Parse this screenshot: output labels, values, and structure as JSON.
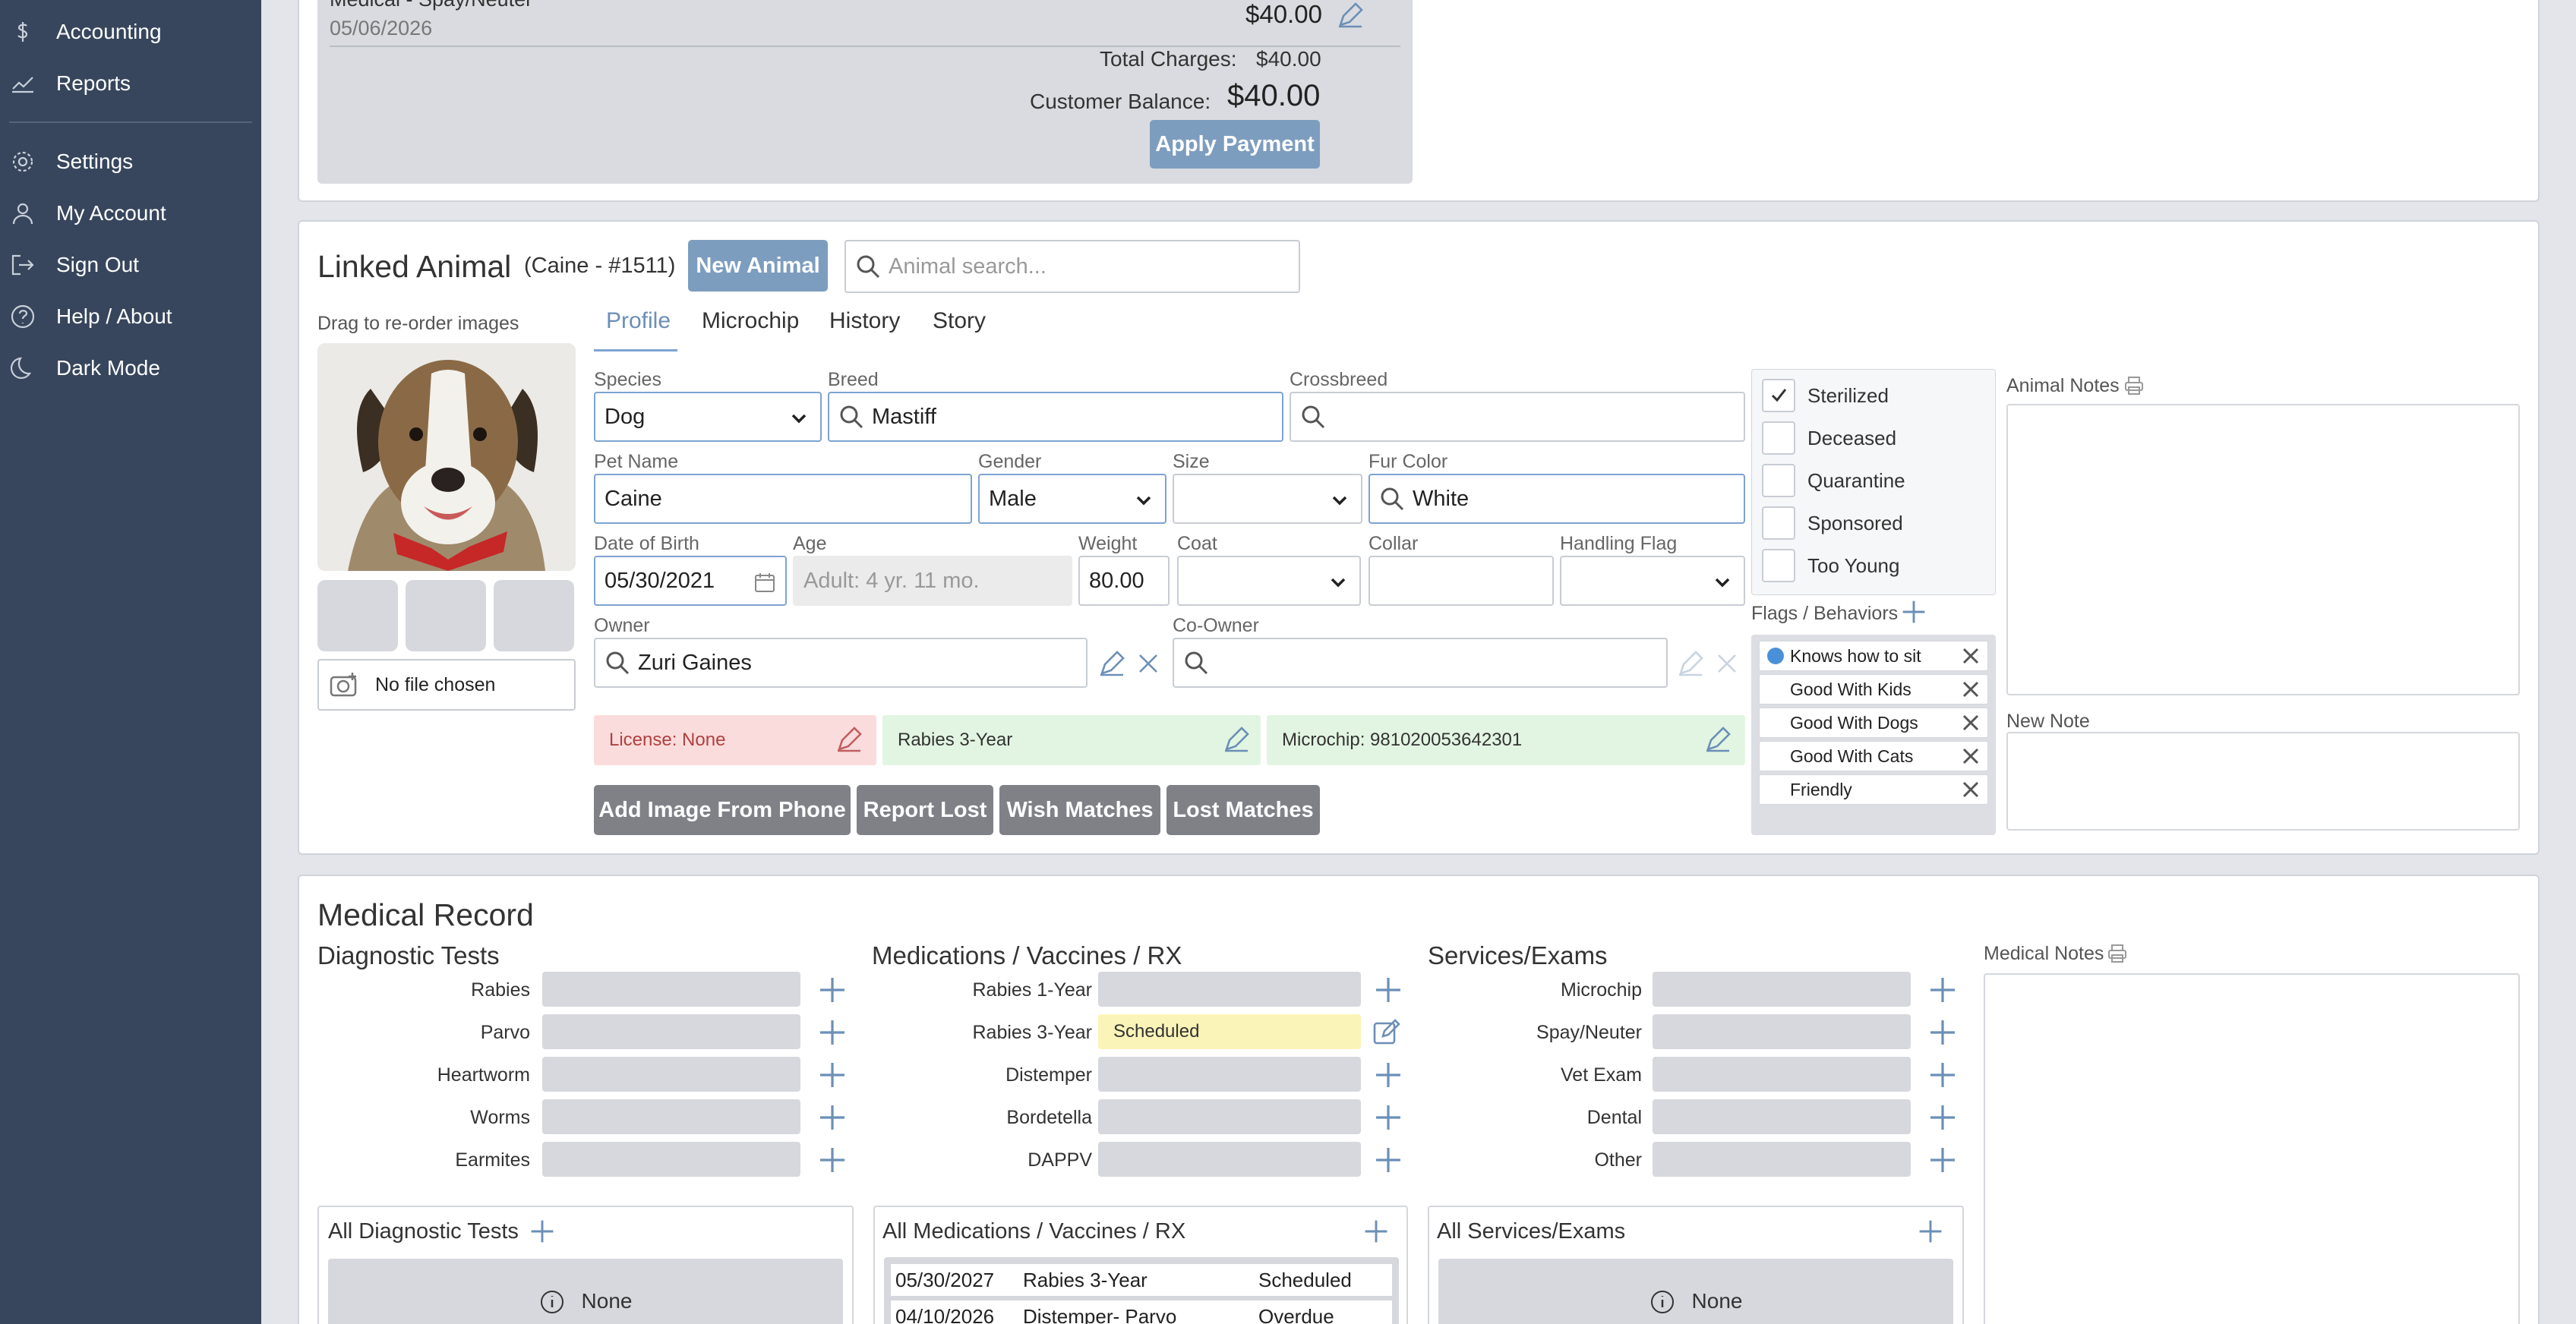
{
  "sidebar": {
    "items": [
      {
        "label": "Accounting",
        "icon": "dollar-icon"
      },
      {
        "label": "Reports",
        "icon": "chart-icon"
      },
      {
        "label": "Settings",
        "icon": "gear-icon"
      },
      {
        "label": "My Account",
        "icon": "user-icon"
      },
      {
        "label": "Sign Out",
        "icon": "sign-out-icon"
      },
      {
        "label": "Help / About",
        "icon": "help-icon"
      },
      {
        "label": "Dark Mode",
        "icon": "moon-icon"
      }
    ]
  },
  "charges": {
    "item_name": "Medical - Spay/Neuter",
    "item_date": "05/06/2026",
    "item_amount": "$40.00",
    "total_label": "Total Charges:",
    "total_value": "$40.00",
    "balance_label": "Customer Balance:",
    "balance_value": "$40.00",
    "apply_payment": "Apply Payment"
  },
  "linked_animal": {
    "title": "Linked Animal",
    "subtitle": "(Caine - #1511)",
    "new_animal": "New Animal",
    "search_placeholder": "Animal search...",
    "drag_hint": "Drag to re-order images",
    "no_file": "No file chosen",
    "tabs": [
      "Profile",
      "Microchip",
      "History",
      "Story"
    ],
    "fields": {
      "species": {
        "label": "Species",
        "value": "Dog"
      },
      "breed": {
        "label": "Breed",
        "value": "Mastiff"
      },
      "crossbreed": {
        "label": "Crossbreed",
        "value": ""
      },
      "pet_name": {
        "label": "Pet Name",
        "value": "Caine"
      },
      "gender": {
        "label": "Gender",
        "value": "Male"
      },
      "size": {
        "label": "Size",
        "value": ""
      },
      "fur_color": {
        "label": "Fur Color",
        "value": "White"
      },
      "dob": {
        "label": "Date of Birth",
        "value": "05/30/2021"
      },
      "age": {
        "label": "Age",
        "value": "Adult: 4 yr. 11 mo."
      },
      "weight": {
        "label": "Weight",
        "value": "80.00"
      },
      "coat": {
        "label": "Coat",
        "value": ""
      },
      "collar": {
        "label": "Collar",
        "value": ""
      },
      "handling_flag": {
        "label": "Handling Flag",
        "value": ""
      },
      "owner": {
        "label": "Owner",
        "value": "Zuri Gaines"
      },
      "co_owner": {
        "label": "Co-Owner",
        "value": ""
      }
    },
    "license": "License: None",
    "rabies": "Rabies 3-Year",
    "microchip": "Microchip: 981020053642301",
    "buttons": [
      "Add Image From Phone",
      "Report Lost",
      "Wish Matches",
      "Lost Matches"
    ],
    "checks": [
      {
        "label": "Sterilized",
        "checked": true
      },
      {
        "label": "Deceased",
        "checked": false
      },
      {
        "label": "Quarantine",
        "checked": false
      },
      {
        "label": "Sponsored",
        "checked": false
      },
      {
        "label": "Too Young",
        "checked": false
      }
    ],
    "flags_title": "Flags / Behaviors",
    "flags": [
      "Knows how to sit",
      "Good With Kids",
      "Good With Dogs",
      "Good With Cats",
      "Friendly"
    ],
    "animal_notes": "Animal Notes",
    "new_note": "New Note"
  },
  "medical": {
    "title": "Medical Record",
    "diagnostic_title": "Diagnostic Tests",
    "diagnostic": [
      "Rabies",
      "Parvo",
      "Heartworm",
      "Worms",
      "Earmites"
    ],
    "meds_title": "Medications / Vaccines / RX",
    "meds": [
      {
        "label": "Rabies 1-Year",
        "status": ""
      },
      {
        "label": "Rabies 3-Year",
        "status": "Scheduled"
      },
      {
        "label": "Distemper",
        "status": ""
      },
      {
        "label": "Bordetella",
        "status": ""
      },
      {
        "label": "DAPPV",
        "status": ""
      }
    ],
    "services_title": "Services/Exams",
    "services": [
      "Microchip",
      "Spay/Neuter",
      "Vet Exam",
      "Dental",
      "Other"
    ],
    "medical_notes": "Medical Notes",
    "all_diag": "All Diagnostic Tests",
    "all_meds": "All Medications / Vaccines / RX",
    "all_services": "All Services/Exams",
    "none": "None",
    "med_rows": [
      {
        "date": "05/30/2027",
        "name": "Rabies 3-Year",
        "status": "Scheduled"
      },
      {
        "date": "04/10/2026",
        "name": "Distemper- Parvo",
        "status": "Overdue"
      }
    ]
  }
}
